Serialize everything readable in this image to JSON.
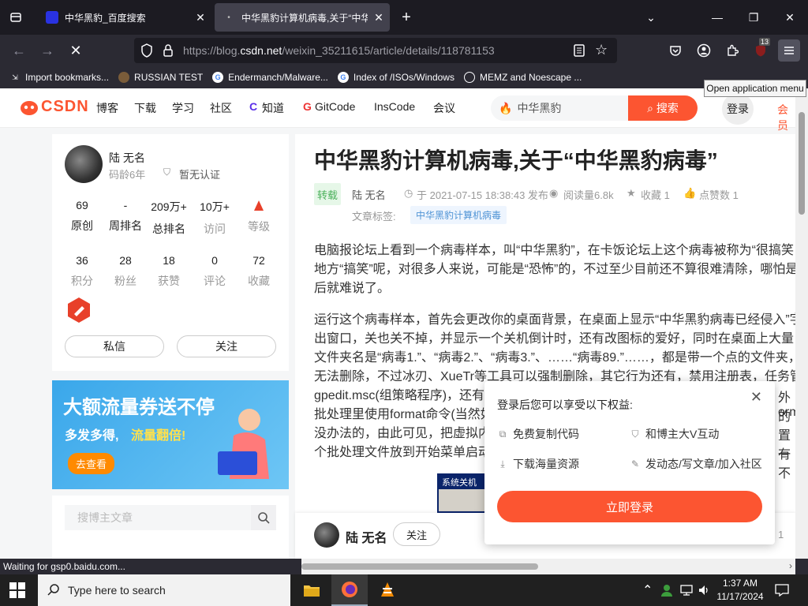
{
  "browser": {
    "tabs": [
      {
        "title": "中华黑豹_百度搜索",
        "close": "✕"
      },
      {
        "title": "中华黑豹计算机病毒,关于“中华",
        "close": "✕"
      }
    ],
    "new_tab": "+",
    "window_controls": {
      "list": "⌄",
      "minimize": "—",
      "maximize": "❐",
      "close": "✕"
    },
    "url_prefix": "https://blog.",
    "url_host": "csdn.net",
    "url_path": "/weixin_35211615/article/details/118781153",
    "extension_badge": "13",
    "tooltip": "Open application menu",
    "bookmarks": [
      {
        "label": "Import bookmarks..."
      },
      {
        "label": "RUSSIAN TEST"
      },
      {
        "label": "Endermanch/Malware..."
      },
      {
        "label": "Index of /ISOs/Windows"
      },
      {
        "label": "MEMZ and Noescape ..."
      }
    ],
    "status": "Waiting for gsp0.baidu.com..."
  },
  "csdn": {
    "logo": "CSDN",
    "nav": [
      "博客",
      "下载",
      "学习",
      "社区",
      "知道",
      "GitCode",
      "InsCode",
      "会议"
    ],
    "search_value": "中华黑豹",
    "search_button": "搜索",
    "login": "登录",
    "vip": "会员"
  },
  "profile": {
    "name": "陆 无名",
    "code_age": "码龄6年",
    "auth": "暂无认证",
    "stats_row1": [
      {
        "num": "69",
        "label": "原创"
      },
      {
        "num": "-",
        "label": "周排名"
      },
      {
        "num": "209万+",
        "label": "总排名"
      },
      {
        "num": "10万+",
        "label": "访问"
      },
      {
        "num": "",
        "label": "等级"
      }
    ],
    "stats_row2": [
      {
        "num": "36",
        "label": "积分"
      },
      {
        "num": "28",
        "label": "粉丝"
      },
      {
        "num": "18",
        "label": "获赞"
      },
      {
        "num": "0",
        "label": "评论"
      },
      {
        "num": "72",
        "label": "收藏"
      }
    ],
    "message_button": "私信",
    "follow_button": "关注"
  },
  "ad": {
    "headline": "大额流量券送不停",
    "sub_a": "多发多得,",
    "sub_b": "流量翻倍!",
    "cta": "去查看"
  },
  "blog_search": {
    "placeholder": "搜博主文章"
  },
  "article": {
    "title": "中华黑豹计算机病毒,关于“中华黑豹病毒”",
    "badge": "转载",
    "author": "陆 无名",
    "date": "于 2021-07-15 18:38:43 发布",
    "views": "阅读量6.8k",
    "favorites": "收藏 1",
    "likes": "点赞数 1",
    "tags_label": "文章标签:",
    "tag": "中华黑豹计算机病毒",
    "para1": [
      "电脑报论坛上看到一个病毒样本，叫“中华黑豹”，在卡饭论坛上这个病毒被称为“很搞笑",
      "地方“搞笑”呢，对很多人来说，可能是“恐怖”的，不过至少目前还不算很难清除，哪怕是",
      "后就难说了。"
    ],
    "para2": [
      "运行这个病毒样本，首先会更改你的桌面背景，在桌面上显示“中华黑豹病毒已经侵入”字",
      "出窗口，关也关不掉，并显示一个关机倒计时，还有改图标的爱好，同时在桌面上大量",
      "文件夹名是“病毒1.”、“病毒2.”、“病毒3.”、……“病毒89.”……，都是带一个点的文件夹，",
      "无法删除，不过冰刃、XueTr等工具可以强制删除，其它行为还有，禁用注册表，任务管",
      "gpedit.msc(组策略程序)，还有",
      "批处理里使用format命令(当然如",
      "没办法的，由此可见，把虚拟内",
      "个批处理文件放到开始菜单启动"
    ],
    "tail_right": [
      "外的",
      "orma",
      "置一",
      "有不"
    ],
    "img_caption": "系统关机"
  },
  "author_bar": {
    "name": "陆 无名",
    "follow": "关注",
    "count": "1"
  },
  "login_popup": {
    "title": "登录后您可以享受以下权益:",
    "perks": [
      "免费复制代码",
      "和博主大V互动",
      "下载海量资源",
      "发动态/写文章/加入社区"
    ],
    "button": "立即登录",
    "close": "✕"
  },
  "taskbar": {
    "search_placeholder": "Type here to search",
    "time": "1:37 AM",
    "date": "11/17/2024"
  },
  "colors": {
    "accent": "#fc5531",
    "browser_bg": "#1c1b22",
    "toolbar_bg": "#2b2a33"
  }
}
